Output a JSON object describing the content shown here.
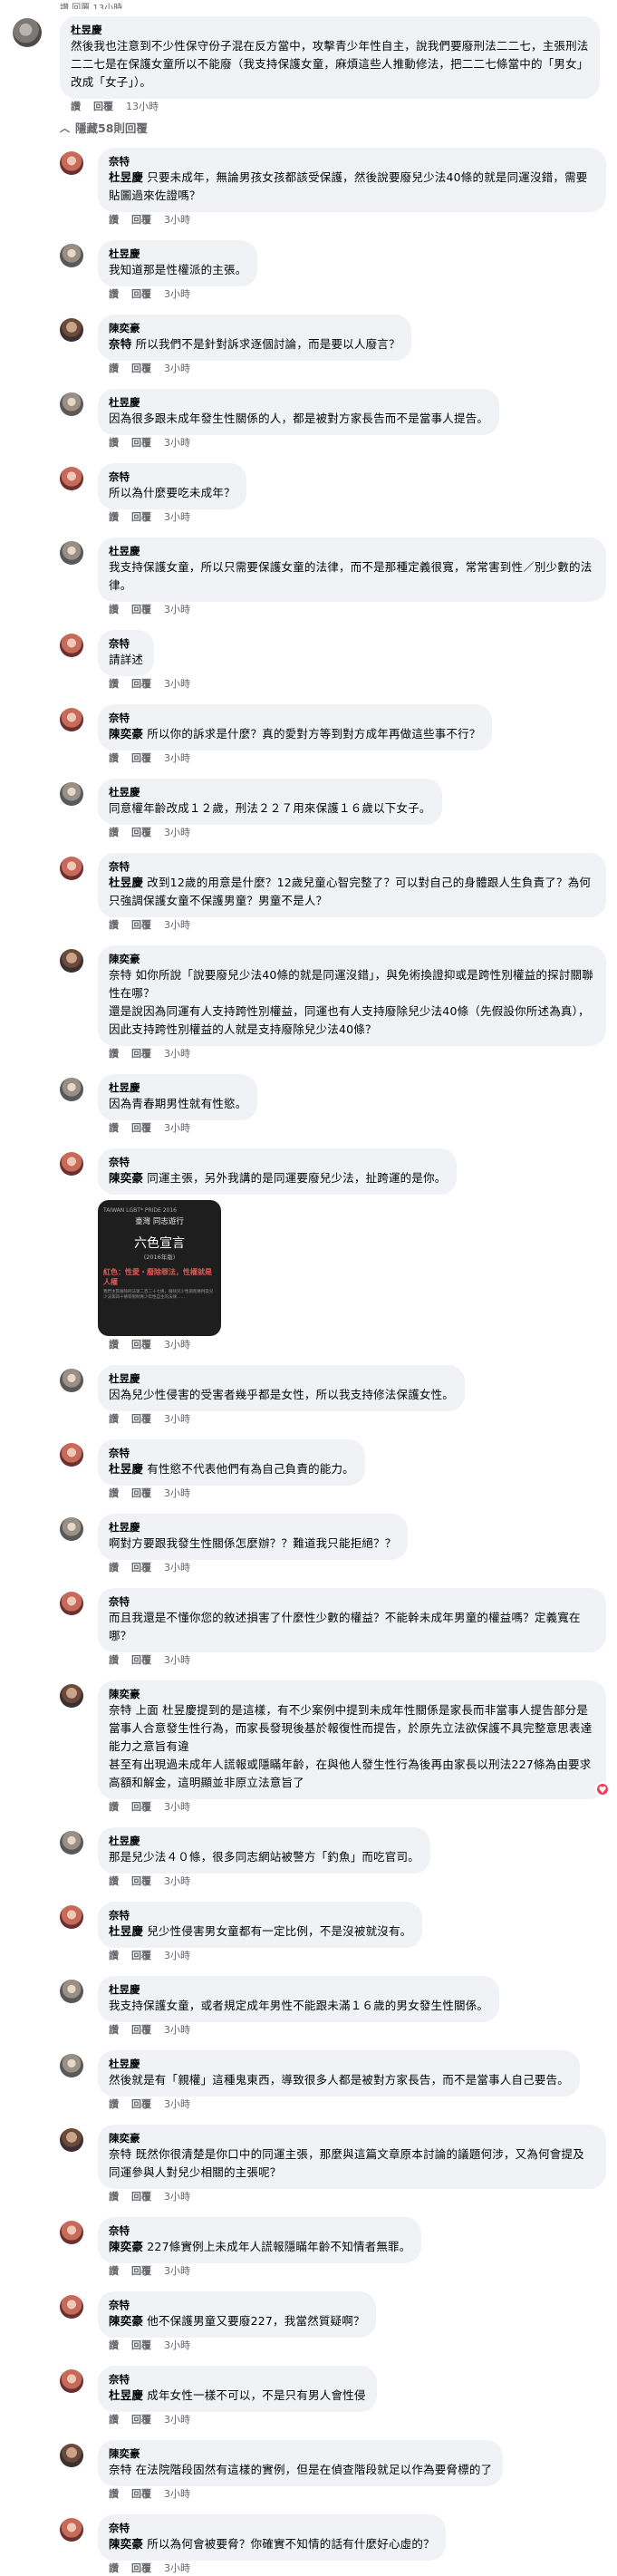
{
  "top_cut": "讚  回覆  13小時",
  "main_comment": {
    "author": "杜昱慶",
    "text": "然後我也注意到不少性保守份子混在反方當中，攻擊青少年性自主，說我們要廢刑法二二七，主張刑法二二七是在保護女童所以不能廢（我支持保護女童，麻煩這些人推動修法，把二二七條當中的「男女」改成「女子」）。",
    "like": "讚",
    "reply": "回覆",
    "time": "13小時"
  },
  "hide_replies": "隱藏58則回覆",
  "hide_icon": "chevron-up-icon",
  "colors": {
    "bubble": "#f0f2f5",
    "meta": "#65676b",
    "reaction_heart": "#f33e58"
  },
  "replies": [
    {
      "author": "奈特",
      "mention": "杜昱慶",
      "text": " 只要未成年，無論男孩女孩都該受保護，然後說要廢兒少法40條的就是同運沒錯，需要貼圖過來佐證嗎？",
      "like": "讚",
      "reply": "回覆",
      "time": "3小時"
    },
    {
      "author": "杜昱慶",
      "mention": "",
      "text": "我知道那是性權派的主張。",
      "like": "讚",
      "reply": "回覆",
      "time": "3小時"
    },
    {
      "author": "陳奕豪",
      "mention": "奈特",
      "text": " 所以我們不是針對訴求逐個討論，而是要以人廢言？",
      "like": "讚",
      "reply": "回覆",
      "time": "3小時"
    },
    {
      "author": "杜昱慶",
      "mention": "",
      "text": "因為很多跟未成年發生性關係的人，都是被對方家長告而不是當事人提告。",
      "like": "讚",
      "reply": "回覆",
      "time": "3小時"
    },
    {
      "author": "奈特",
      "mention": "",
      "text": "所以為什麼要吃未成年？",
      "like": "讚",
      "reply": "回覆",
      "time": "3小時"
    },
    {
      "author": "杜昱慶",
      "mention": "",
      "text": "我支持保護女童，所以只需要保護女童的法律，而不是那種定義很寬，常常害到性／別少數的法律。",
      "like": "讚",
      "reply": "回覆",
      "time": "3小時"
    },
    {
      "author": "奈特",
      "mention": "",
      "text": "請詳述",
      "like": "讚",
      "reply": "回覆",
      "time": "3小時"
    },
    {
      "author": "奈特",
      "mention": "陳奕豪",
      "text": " 所以你的訴求是什麼？真的愛對方等到對方成年再做這些事不行？",
      "like": "讚",
      "reply": "回覆",
      "time": "3小時"
    },
    {
      "author": "杜昱慶",
      "mention": "",
      "text": "同意權年齡改成１２歲，刑法２２７用來保護１６歲以下女子。",
      "like": "讚",
      "reply": "回覆",
      "time": "3小時"
    },
    {
      "author": "奈特",
      "mention": "杜昱慶",
      "text": " 改到12歲的用意是什麼？12歲兒童心智完整了？可以對自己的身體跟人生負責了？為何只強調保護女童不保護男童？男童不是人？",
      "like": "讚",
      "reply": "回覆",
      "time": "3小時"
    },
    {
      "author": "陳奕豪",
      "mention": "",
      "text": "奈特 如你所說「說要廢兒少法40條的就是同運沒錯」，與免術換證抑或是跨性別權益的探討關聯性在哪？\n還是說因為同運有人支持跨性別權益，同運也有人支持廢除兒少法40條（先假設你所述為真），因此支持跨性別權益的人就是支持廢除兒少法40條？",
      "like": "讚",
      "reply": "回覆",
      "time": "3小時"
    },
    {
      "author": "杜昱慶",
      "mention": "",
      "text": "因為青春期男性就有性慾。",
      "like": "讚",
      "reply": "回覆",
      "time": "3小時"
    },
    {
      "author": "奈特",
      "mention": "陳奕豪",
      "text": " 同運主張，另外我講的是同運要廢兒少法，扯跨運的是你。",
      "like": "讚",
      "reply": "回覆",
      "time": "3小時",
      "attachment": {
        "header": "TAIWAN LGBT* PRIDE 2016",
        "org": "臺灣 同志遊行",
        "title": "六色宣言",
        "year": "(2016年版)",
        "red_heading": "紅色：性愛・廢除罪法，性權就是人權",
        "body": "我們主張廢除刑法第二百二十七條，廢除兒少性剝削條例及兒少法第四十條等限制青少年性自主的法律……"
      }
    },
    {
      "author": "杜昱慶",
      "mention": "",
      "text": "因為兒少性侵害的受害者幾乎都是女性，所以我支持修法保護女性。",
      "like": "讚",
      "reply": "回覆",
      "time": "3小時"
    },
    {
      "author": "奈特",
      "mention": "杜昱慶",
      "text": " 有性慾不代表他們有為自己負責的能力。",
      "like": "讚",
      "reply": "回覆",
      "time": "3小時"
    },
    {
      "author": "杜昱慶",
      "mention": "",
      "text": "啊對方要跟我發生性關係怎麼辦？？難道我只能拒絕？？",
      "like": "讚",
      "reply": "回覆",
      "time": "3小時"
    },
    {
      "author": "奈特",
      "mention": "",
      "text": "而且我還是不懂你您的敘述損害了什麼性少數的權益？不能幹未成年男童的權益嗎？定義寬在哪？",
      "like": "讚",
      "reply": "回覆",
      "time": "3小時"
    },
    {
      "author": "陳奕豪",
      "mention": "",
      "text": "奈特 上面 杜昱慶提到的是這樣，有不少案例中提到未成年性關係是家長而非當事人提告部分是當事人合意發生性行為，而家長發現後基於報復性而提告，於原先立法欲保護不具完整意思表達能力之意旨有違\n甚至有出現過未成年人謊報或隱瞞年齡，在與他人發生性行為後再由家長以刑法227條為由要求高額和解金，這明顯並非原立法意旨了",
      "like": "讚",
      "reply": "回覆",
      "time": "3小時",
      "reaction": "heart-icon"
    },
    {
      "author": "杜昱慶",
      "mention": "",
      "text": "那是兒少法４０條，很多同志網站被警方「釣魚」而吃官司。",
      "like": "讚",
      "reply": "回覆",
      "time": "3小時"
    },
    {
      "author": "奈特",
      "mention": "杜昱慶",
      "text": " 兒少性侵害男女童都有一定比例，不是沒被就沒有。",
      "like": "讚",
      "reply": "回覆",
      "time": "3小時"
    },
    {
      "author": "杜昱慶",
      "mention": "",
      "text": "我支持保護女童，或者規定成年男性不能跟未滿１６歲的男女發生性關係。",
      "like": "讚",
      "reply": "回覆",
      "time": "3小時"
    },
    {
      "author": "杜昱慶",
      "mention": "",
      "text": "然後就是有「親權」這種鬼東西，導致很多人都是被對方家長告，而不是當事人自己要告。",
      "like": "讚",
      "reply": "回覆",
      "time": "3小時"
    },
    {
      "author": "陳奕豪",
      "mention": "",
      "text": "奈特 既然你很清楚是你口中的同運主張，那麼與這篇文章原本討論的議題何涉，又為何會提及同運參與人對兒少相關的主張呢？",
      "like": "讚",
      "reply": "回覆",
      "time": "3小時"
    },
    {
      "author": "奈特",
      "mention": "陳奕豪",
      "text": " 227條實例上未成年人謊報隱瞞年齡不知情者無罪。",
      "like": "讚",
      "reply": "回覆",
      "time": "3小時"
    },
    {
      "author": "奈特",
      "mention": "陳奕豪",
      "text": " 他不保護男童又要廢227，我當然質疑啊？",
      "like": "讚",
      "reply": "回覆",
      "time": "3小時"
    },
    {
      "author": "奈特",
      "mention": "杜昱慶",
      "text": " 成年女性一樣不可以，不是只有男人會性侵",
      "like": "讚",
      "reply": "回覆",
      "time": "3小時"
    },
    {
      "author": "陳奕豪",
      "mention": "",
      "text": "奈特 在法院階段固然有這樣的實例，但是在偵查階段就足以作為要脅標的了",
      "like": "讚",
      "reply": "回覆",
      "time": "3小時"
    },
    {
      "author": "奈特",
      "mention": "陳奕豪",
      "text": " 所以為何會被要脅？你確實不知情的話有什麼好心虛的？",
      "like": "讚",
      "reply": "回覆",
      "time": "3小時"
    }
  ]
}
